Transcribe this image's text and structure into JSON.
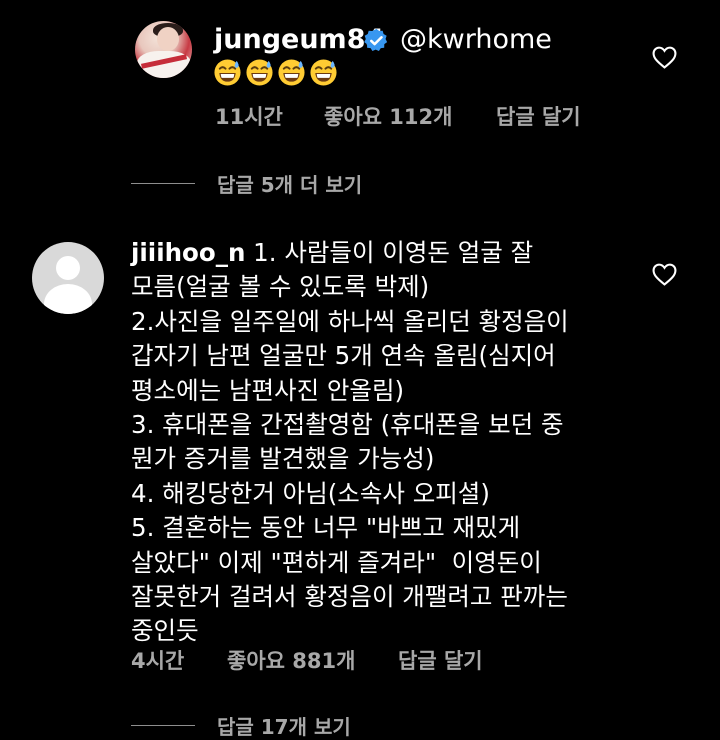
{
  "reply": {
    "username": "jungeum84",
    "verified": true,
    "mention": "@kwrhome",
    "emojis": [
      "grinning-sweat-emoji",
      "grinning-sweat-emoji",
      "grinning-sweat-emoji",
      "grinning-sweat-emoji"
    ],
    "time": "11시간",
    "likes": "좋아요 112개",
    "reply_action": "답글 달기",
    "view_replies": "답글 5개 더 보기"
  },
  "comment": {
    "username": "jiiihoo_n",
    "lines": [
      " 1. 사람들이 이영돈 얼굴 잘",
      "모름(얼굴 볼 수 있도록 박제)",
      "2.사진을 일주일에 하나씩 올리던 황정음이",
      "갑자기 남편 얼굴만 5개 연속 올림(심지어",
      "평소에는 남편사진 안올림)",
      "3. 휴대폰을 간접촬영함 (휴대폰을 보던 중",
      "뭔가 증거를 발견했을 가능성)",
      "4. 해킹당한거 아님(소속사 오피셜)",
      "5. 결혼하는 동안 너무 \"바쁘고 재밌게",
      "살았다\" 이제 \"편하게 즐겨라\"  이영돈이",
      "잘못한거 걸려서 황정음이 개팰려고 판까는",
      "중인듯"
    ],
    "time": "4시간",
    "likes": "좋아요 881개",
    "reply_action": "답글 달기",
    "view_replies": "답글 17개 보기"
  },
  "colors": {
    "background": "#000000",
    "text": "#ffffff",
    "secondary": "#a8a8a8",
    "verified": "#3897f0"
  }
}
